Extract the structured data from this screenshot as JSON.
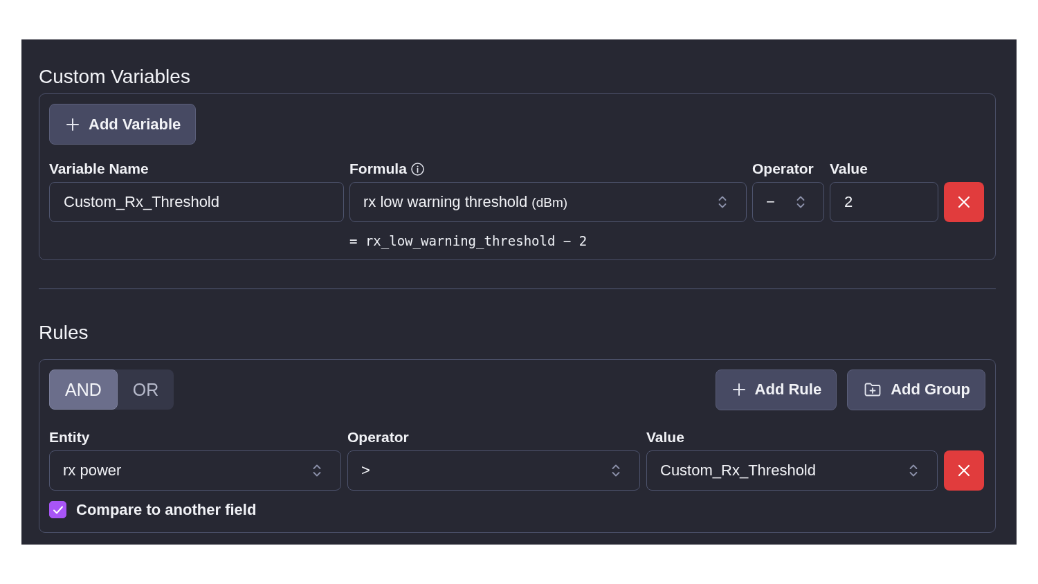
{
  "custom_variables": {
    "title": "Custom Variables",
    "add_button": {
      "label": "Add Variable"
    },
    "labels": {
      "name": "Variable Name",
      "formula": "Formula",
      "operator": "Operator",
      "value": "Value"
    },
    "variables": [
      {
        "name": "Custom_Rx_Threshold",
        "formula": "rx low warning threshold",
        "unit": "(dBm)",
        "operator": "−",
        "value": "2",
        "expression": "= rx_low_warning_threshold − 2"
      }
    ]
  },
  "rules": {
    "title": "Rules",
    "combinators": [
      {
        "label": "AND",
        "selected": true
      },
      {
        "label": "OR",
        "selected": false
      }
    ],
    "buttons": [
      {
        "kind": "add",
        "label": "Add Rule"
      },
      {
        "kind": "group",
        "label": "Add Group"
      }
    ],
    "labels": {
      "entity": "Entity",
      "operator": "Operator",
      "value": "Value"
    },
    "items": [
      {
        "entity": "rx power",
        "operator": ">",
        "value": "Custom_Rx_Threshold",
        "compare": {
          "label": "Compare to another field",
          "checked": true
        }
      }
    ]
  }
}
